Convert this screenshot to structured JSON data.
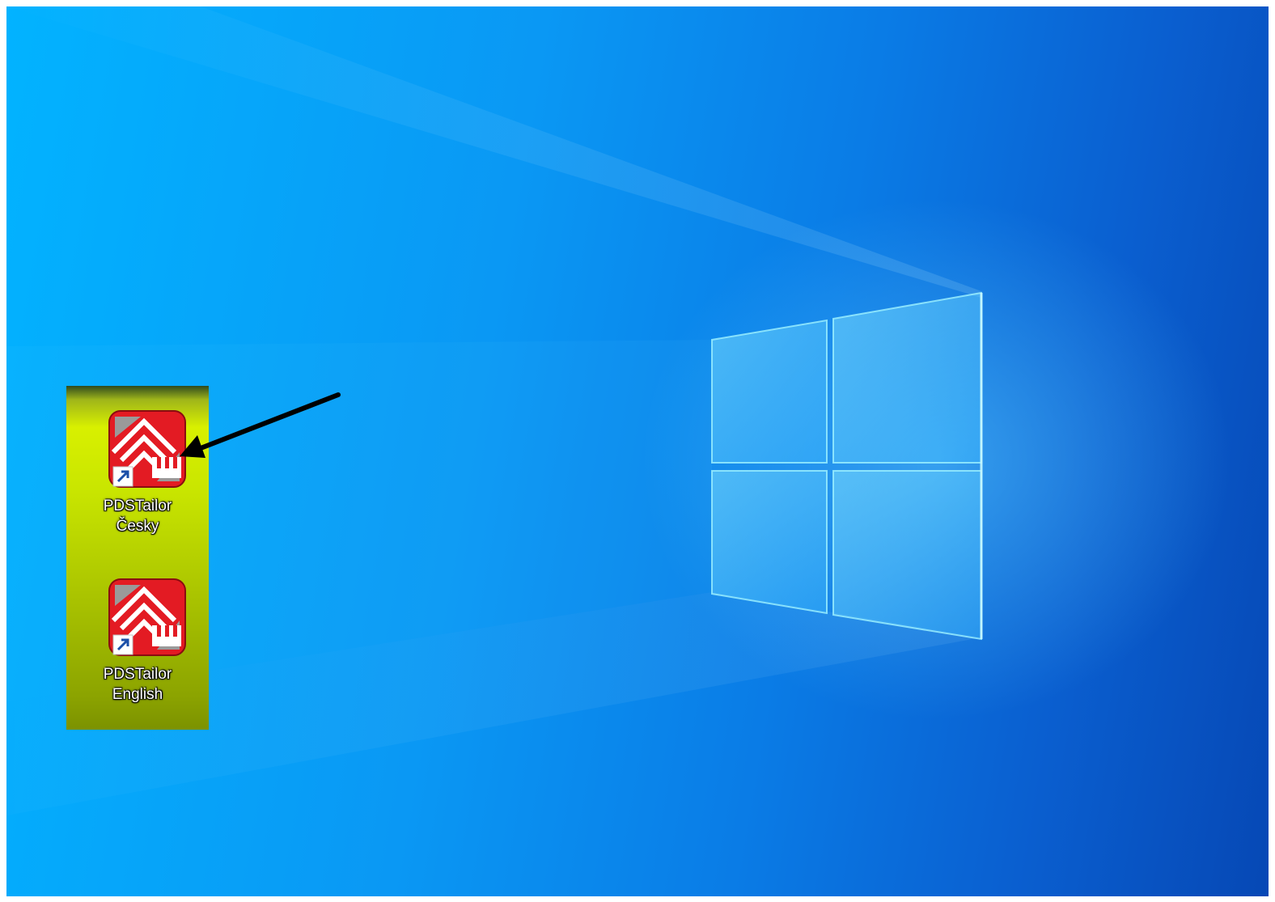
{
  "desktop": {
    "wallpaper": "windows-10-light-beam",
    "accent_color": "#0a8cf0",
    "icons": [
      {
        "name": "PDSTailor Česky",
        "label_line1": "PDSTailor",
        "label_line2": "Česky",
        "icon": "pdstailor-house-icon",
        "shortcut": true
      },
      {
        "name": "PDSTailor English",
        "label_line1": "PDSTailor",
        "label_line2": "English",
        "icon": "pdstailor-house-icon",
        "shortcut": true
      }
    ],
    "annotation": {
      "icon": "black-arrow-icon",
      "points_to": "PDSTailor Česky"
    }
  },
  "colors": {
    "highlight": "#c9e600",
    "icon_red": "#e31b23",
    "arrow": "#000000"
  }
}
